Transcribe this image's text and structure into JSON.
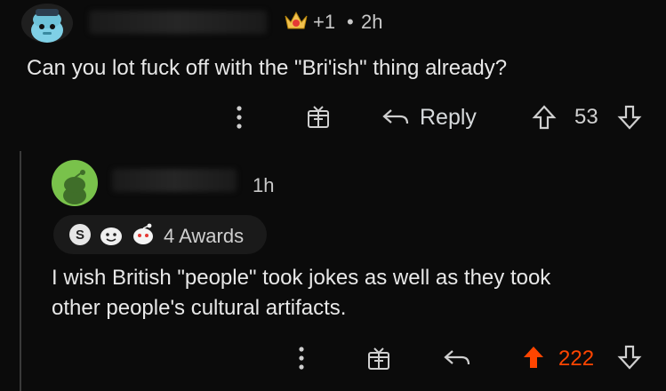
{
  "comment1": {
    "award_count": "+1",
    "separator": "•",
    "timestamp": "2h",
    "body": "Can you lot fuck off with the \"Bri'ish\" thing already?",
    "reply_label": "Reply",
    "votes": "53",
    "more_icon": "ellipsis-vertical-icon",
    "award_icon": "gift-icon"
  },
  "comment2": {
    "timestamp": "1h",
    "awards_label": "4 Awards",
    "body_line1": "I wish British \"people\" took jokes as well as they took",
    "body_line2": "other people's cultural artifacts.",
    "votes": "222",
    "upvote_color": "#ff4500"
  }
}
